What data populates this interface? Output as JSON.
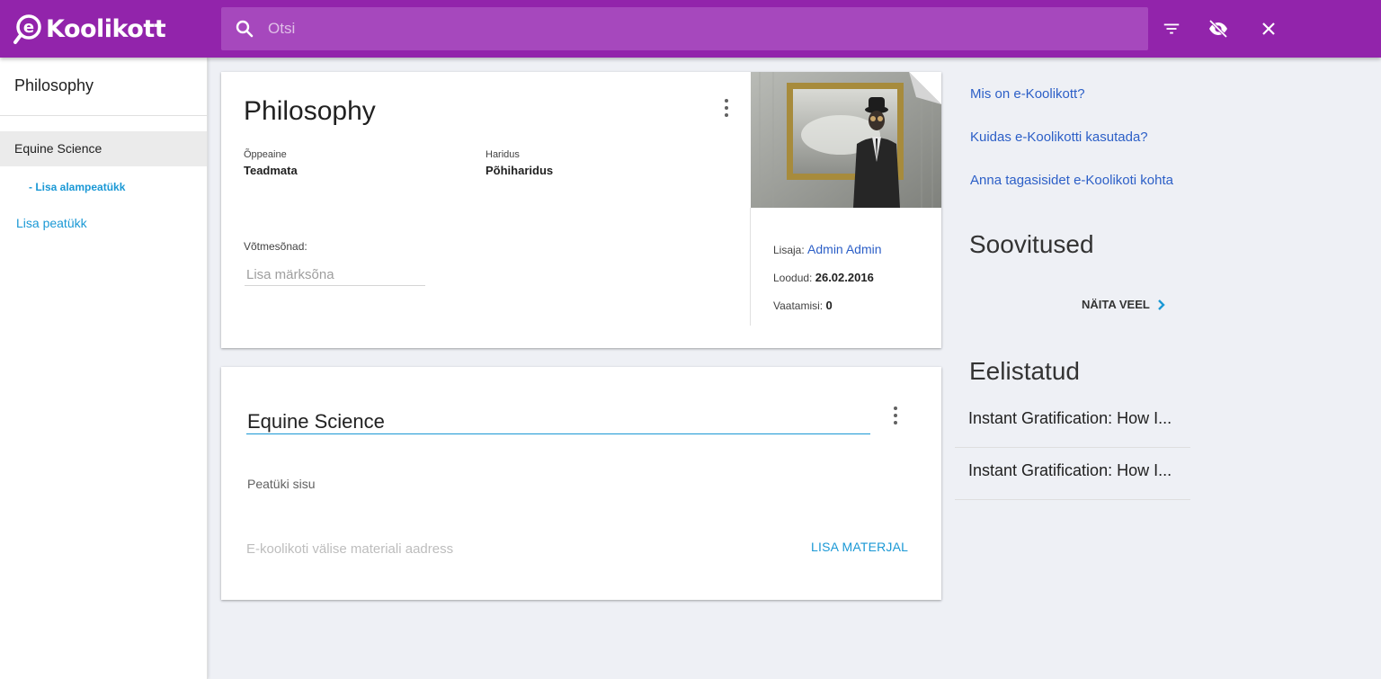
{
  "brand": {
    "logo_text": "Koolikott",
    "accent": "#9224ab",
    "link_color": "#1a98d5"
  },
  "search": {
    "placeholder": "Otsi"
  },
  "toolbar": {
    "icons": [
      "filter-icon",
      "visibility-off-icon",
      "close-icon"
    ]
  },
  "sidebar": {
    "title": "Philosophy",
    "items": [
      {
        "label": "Equine Science",
        "selected": true,
        "subitem": "- Lisa alampeatükk"
      }
    ],
    "add_chapter": "Lisa peatükk"
  },
  "material": {
    "title": "Philosophy",
    "subject_label": "Õppeaine",
    "subject_value": "Teadmata",
    "education_label": "Haridus",
    "education_value": "Põhiharidus",
    "keywords_label": "Võtmesõnad:",
    "keywords_placeholder": "Lisa märksõna",
    "added_by_label": "Lisaja:",
    "added_by_value": "Admin Admin",
    "created_label": "Loodud:",
    "created_value": "26.02.2016",
    "views_label": "Vaatamisi:",
    "views_value": "0"
  },
  "chapter": {
    "title": "Equine Science",
    "content_placeholder": "Peatüki sisu",
    "url_placeholder": "E-koolikoti välise materiali aadress",
    "add_material": "LISA MATERJAL"
  },
  "right": {
    "links": [
      "Mis on e-Koolikott?",
      "Kuidas e-Koolikotti kasutada?",
      "Anna tagasisidet e-Koolikoti kohta"
    ],
    "recommendations_title": "Soovitused",
    "show_more": "NÄITA VEEL",
    "favorites_title": "Eelistatud",
    "favorites": [
      "Instant Gratification: How I...",
      "Instant Gratification: How I..."
    ]
  }
}
